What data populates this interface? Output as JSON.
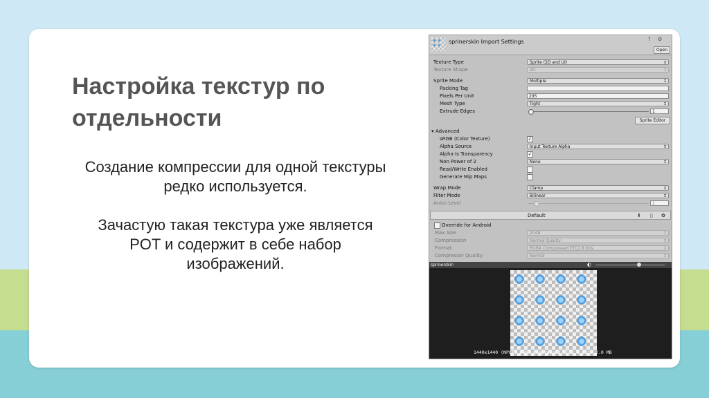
{
  "slide": {
    "title": "Настройка текстур по отдельности",
    "paragraphs": [
      "Создание компрессии для одной текстуры редко используется.",
      "Зачастую такая текстура уже является POT и содержит в себе набор изображений."
    ]
  },
  "inspector": {
    "header_title": "sprinerskin Import Settings",
    "open_label": "Open",
    "texture_type": {
      "label": "Texture Type",
      "value": "Sprite (2D and UI)"
    },
    "texture_shape": {
      "label": "Texture Shape",
      "value": "2D"
    },
    "sprite_mode": {
      "label": "Sprite Mode",
      "value": "Multiple"
    },
    "packing_tag": {
      "label": "Packing Tag",
      "value": ""
    },
    "pixels_per_unit": {
      "label": "Pixels Per Unit",
      "value": "295"
    },
    "mesh_type": {
      "label": "Mesh Type",
      "value": "Tight"
    },
    "extrude_edges": {
      "label": "Extrude Edges",
      "value": "1"
    },
    "sprite_editor_label": "Sprite Editor",
    "advanced_label": "Advanced",
    "srgb": {
      "label": "sRGB (Color Texture)",
      "checked": true
    },
    "alpha_source": {
      "label": "Alpha Source",
      "value": "Input Texture Alpha"
    },
    "alpha_transparency": {
      "label": "Alpha Is Transparency",
      "checked": true
    },
    "non_power_of_2": {
      "label": "Non Power of 2",
      "value": "None"
    },
    "read_write": {
      "label": "Read/Write Enabled",
      "checked": false
    },
    "mip_maps": {
      "label": "Generate Mip Maps",
      "checked": false
    },
    "wrap_mode": {
      "label": "Wrap Mode",
      "value": "Clamp"
    },
    "filter_mode": {
      "label": "Filter Mode",
      "value": "Bilinear"
    },
    "aniso_level": {
      "label": "Aniso Level",
      "value": "1"
    },
    "platform_default": "Default",
    "override_android": {
      "label": "Override for Android",
      "checked": false
    },
    "max_size": {
      "label": "Max Size",
      "value": "2048"
    },
    "compression": {
      "label": "Compression",
      "value": "Normal Quality"
    },
    "format": {
      "label": "Format",
      "value": "RGBA Compressed ETC2 8 bits"
    },
    "compressor_quality": {
      "label": "Compressor Quality",
      "value": "Normal"
    },
    "preview_name": "sprinerskin",
    "preview_info": "1440x1440 (NPOT) RGBA Compressed ETC2 8 bits 2.0 MB"
  }
}
